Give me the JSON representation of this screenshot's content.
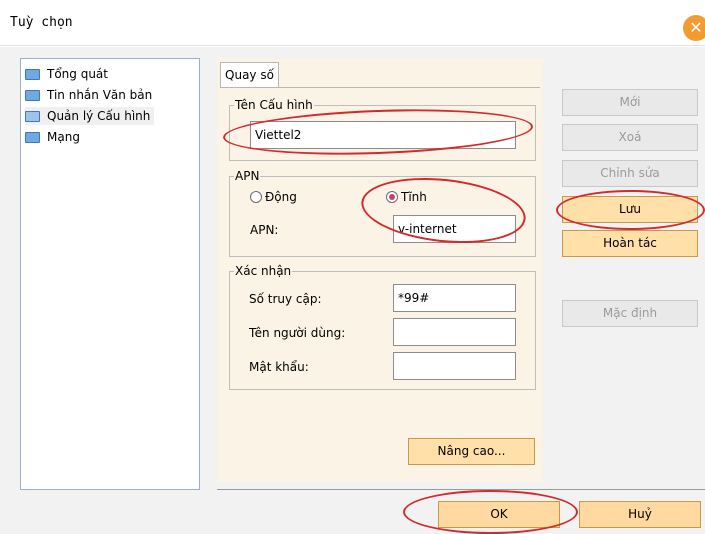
{
  "window": {
    "title": "Tuỳ chọn",
    "close_icon": "close-icon",
    "accent": "#f29b2f"
  },
  "tree": {
    "items": [
      {
        "label": "Tổng quát",
        "icon": "folder-icon"
      },
      {
        "label": "Tin nhắn Văn bản",
        "icon": "folder-icon"
      },
      {
        "label": "Quản lý Cấu hình",
        "icon": "folder-open-icon",
        "selected": true
      },
      {
        "label": "Mạng",
        "icon": "folder-icon"
      }
    ]
  },
  "panel": {
    "tab_label": "Quay số",
    "config_name": {
      "legend": "Tên Cấu hình",
      "value": "Viettel2"
    },
    "apn": {
      "legend": "APN",
      "dynamic_label": "Động",
      "static_label": "Tĩnh",
      "selected": "Tĩnh",
      "apn_label": "APN:",
      "apn_value": "v-internet"
    },
    "auth": {
      "legend": "Xác nhận",
      "access_label": "Số truy cập:",
      "access_value": "*99#",
      "username_label": "Tên người dùng:",
      "username_value": "",
      "password_label": "Mật khẩu:",
      "password_value": ""
    },
    "advanced_label": "Nâng cao..."
  },
  "actions": {
    "new_label": "Mới",
    "delete_label": "Xoá",
    "edit_label": "Chỉnh sửa",
    "save_label": "Lưu",
    "undo_label": "Hoàn tác",
    "default_label": "Mặc định"
  },
  "footer": {
    "ok_label": "OK",
    "cancel_label": "Huỷ"
  },
  "colors": {
    "highlight_ring": "#d42a2a",
    "active_button": "#ffe0a8",
    "panel_bg": "#fbf4e6"
  }
}
